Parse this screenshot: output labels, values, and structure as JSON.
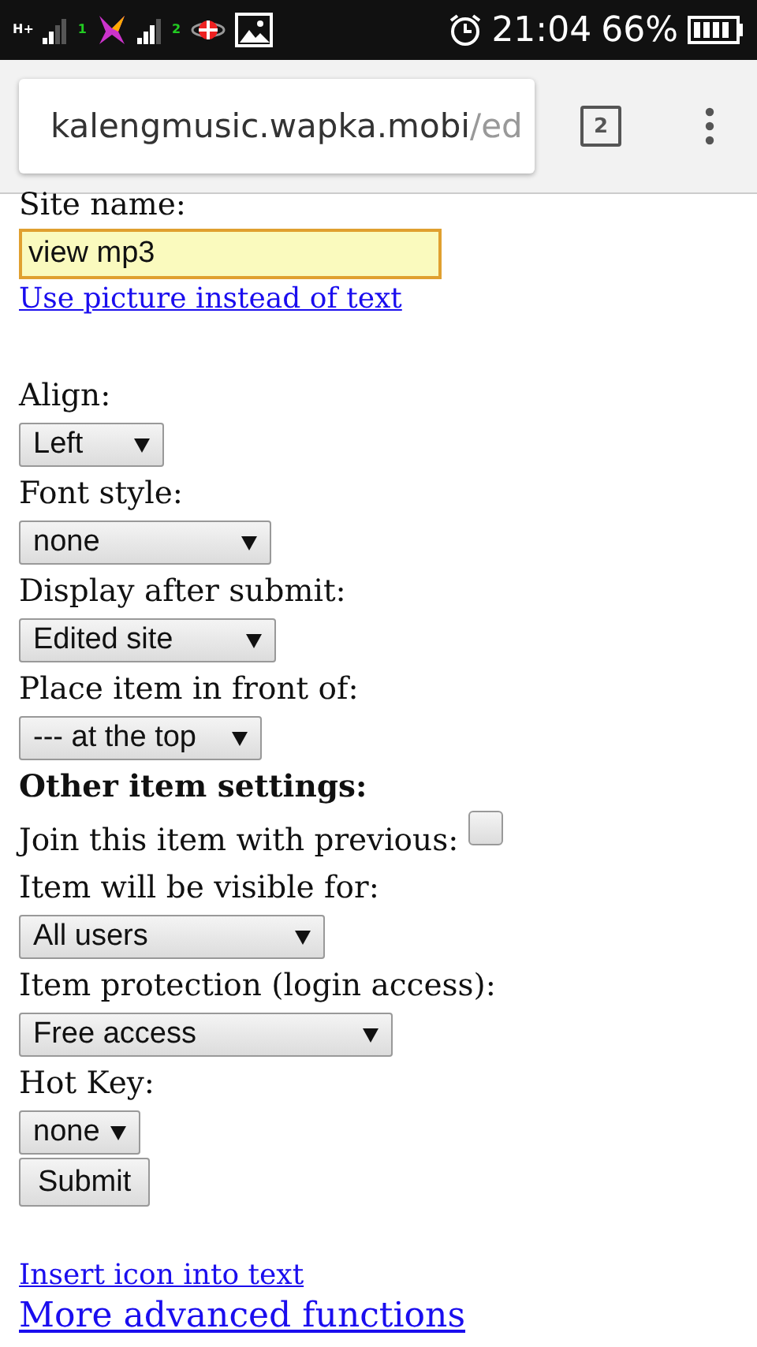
{
  "status_bar": {
    "network_type": "H+",
    "sims": [
      "1",
      "2"
    ],
    "time": "21:04",
    "battery": "66%"
  },
  "browser": {
    "url_host": "kalengmusic.wapka.mobi",
    "url_path": "/ed",
    "tab_count": "2"
  },
  "form": {
    "site_name": {
      "label": "Site name:",
      "value": "view mp3"
    },
    "picture_link": "Use picture instead of text",
    "fields": [
      {
        "kind": "select",
        "label": "Align:",
        "value": "Left"
      },
      {
        "kind": "select",
        "label": "Font style:",
        "value": "none"
      },
      {
        "kind": "select",
        "label": "Display after submit:",
        "value": "Edited site"
      },
      {
        "kind": "select",
        "label": "Place item in front of:",
        "value": "--- at the top"
      },
      {
        "kind": "heading",
        "label": "Other item settings:"
      },
      {
        "kind": "checkbox",
        "label": "Join this item with previous:",
        "checked": false
      },
      {
        "kind": "select",
        "label": "Item will be visible for:",
        "value": "All users"
      },
      {
        "kind": "select",
        "label": "Item protection (login access):",
        "value": "Free access"
      },
      {
        "kind": "select",
        "label": "Hot Key:",
        "value": "none"
      }
    ],
    "submit": "Submit",
    "links": [
      {
        "label": "Insert icon into text",
        "kind": "small"
      },
      {
        "label": "More advanced functions",
        "kind": "large"
      }
    ]
  }
}
